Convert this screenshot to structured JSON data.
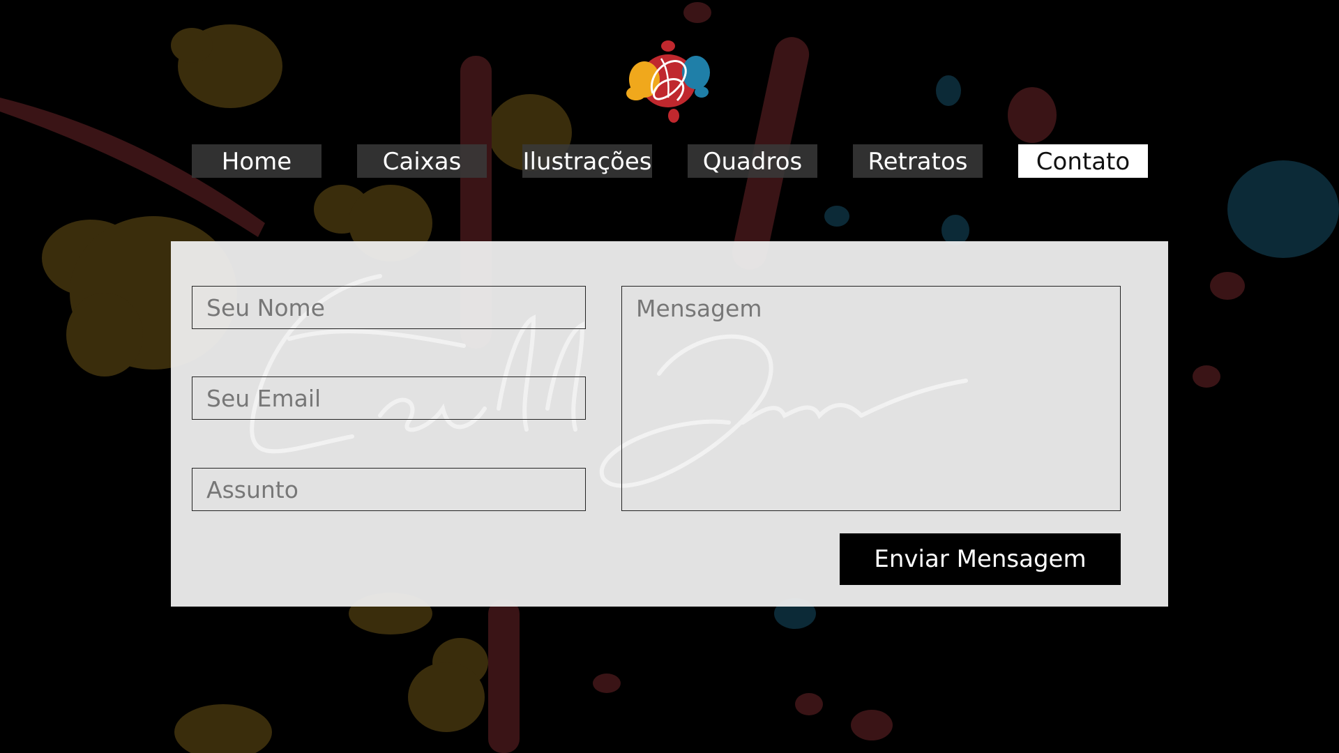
{
  "logo": {
    "icon": "paint-splash-signature-logo",
    "colors": [
      "#f0a81c",
      "#c0282e",
      "#1f7fa8"
    ]
  },
  "nav": {
    "items": [
      {
        "label": "Home",
        "active": false
      },
      {
        "label": "Caixas",
        "active": false
      },
      {
        "label": "Ilustrações",
        "active": false
      },
      {
        "label": "Quadros",
        "active": false
      },
      {
        "label": "Retratos",
        "active": false
      },
      {
        "label": "Contato",
        "active": true
      }
    ]
  },
  "form": {
    "name_placeholder": "Seu Nome",
    "email_placeholder": "Seu Email",
    "subject_placeholder": "Assunto",
    "message_placeholder": "Mensagem",
    "submit_label": "Enviar Mensagem",
    "watermark_icon": "signature-watermark"
  },
  "theme": {
    "background": "#000000",
    "splash_yellow": "#3d300c",
    "splash_red": "#3a1416",
    "splash_blue": "#0c2b38",
    "active_nav_bg": "#ffffff",
    "button_bg": "#000000"
  }
}
